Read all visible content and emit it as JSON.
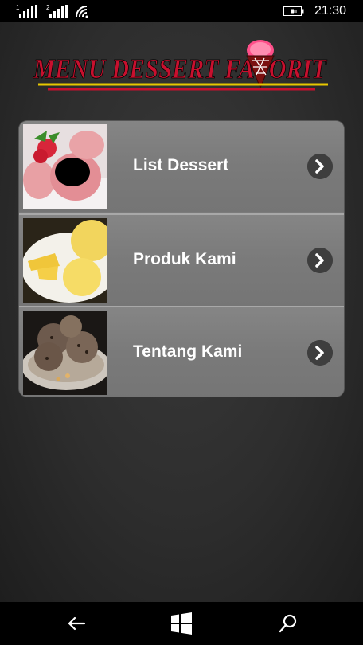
{
  "status_bar": {
    "sim1_label": "1",
    "sim2_label": "2",
    "time": "21:30",
    "icons": [
      "signal-icon",
      "signal-icon",
      "wifi-icon",
      "battery-charging-icon"
    ]
  },
  "header": {
    "logo_text": "MENU DESSERT FAVORIT",
    "colors": {
      "logo_text": "#c8102e",
      "underline": "#c8102e",
      "accent_line": "#e8c800"
    }
  },
  "menu": {
    "items": [
      {
        "label": "List Dessert",
        "image": "strawberry-ice-cream",
        "icon": "chevron-right-icon"
      },
      {
        "label": "Produk Kami",
        "image": "yellow-ice-cream",
        "icon": "chevron-right-icon"
      },
      {
        "label": "Tentang Kami",
        "image": "chocolate-ice-cream",
        "icon": "chevron-right-icon"
      }
    ]
  },
  "nav_bar": {
    "icons": [
      "back-arrow-icon",
      "windows-start-icon",
      "search-icon"
    ]
  }
}
